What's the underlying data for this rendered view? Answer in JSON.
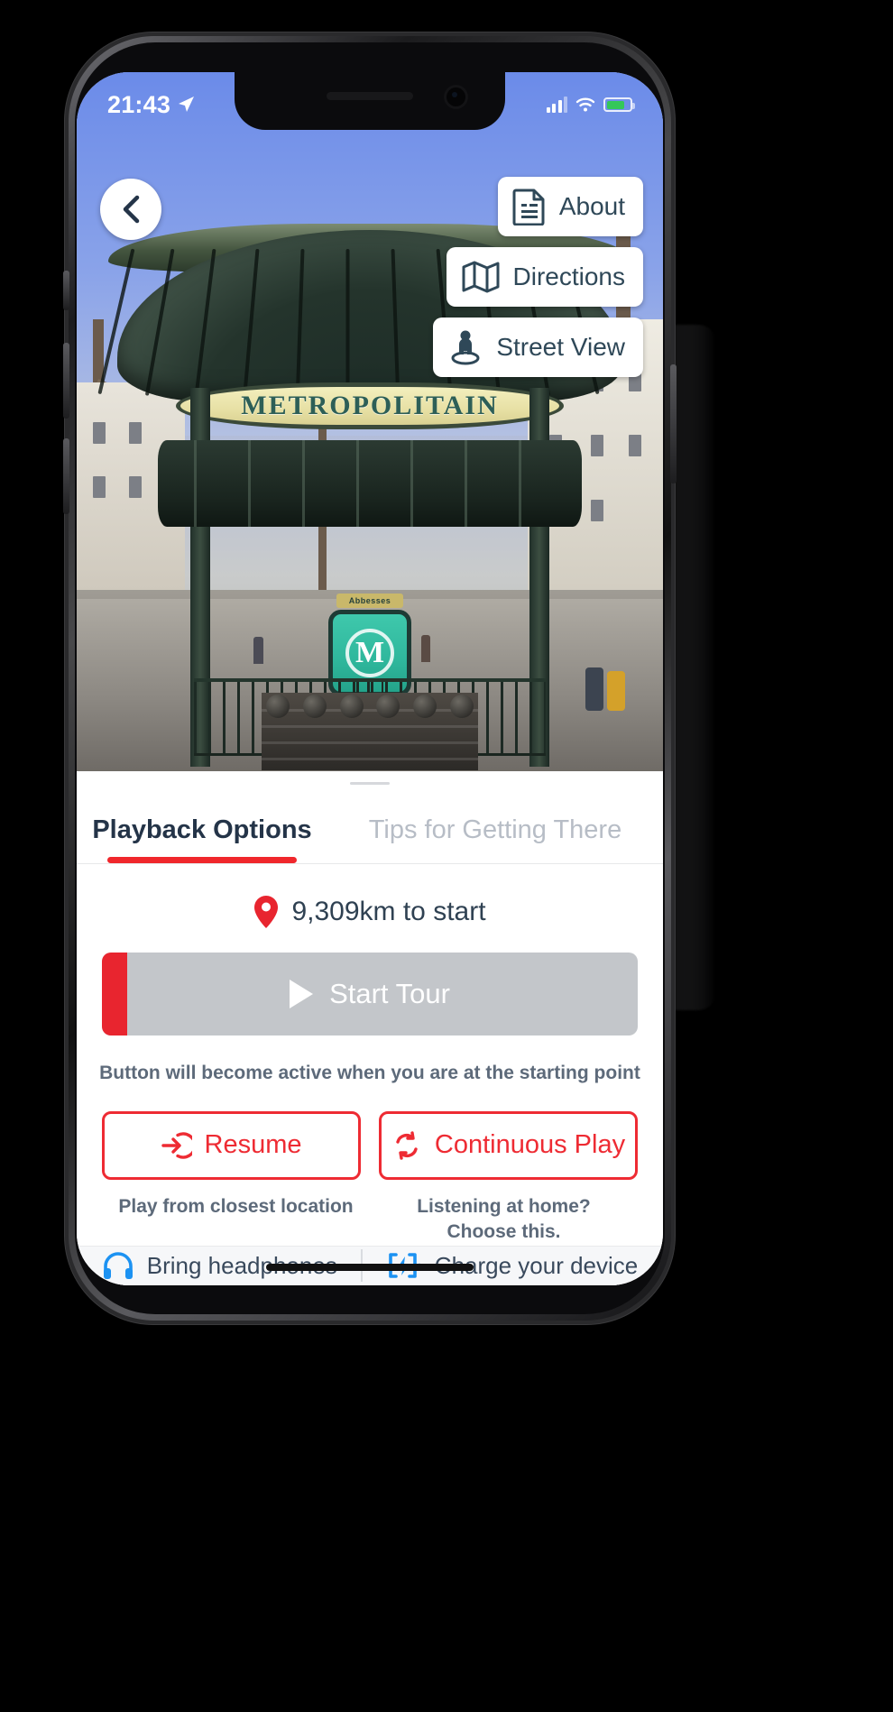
{
  "status_bar": {
    "time": "21:43",
    "location_arrow_icon": "location-arrow-icon",
    "cellular_icon": "cellular-bars-icon",
    "wifi_icon": "wifi-icon",
    "battery_icon": "battery-charging-icon"
  },
  "hero": {
    "back_icon": "chevron-left-icon",
    "sign_text": "METROPOLITAIN",
    "station_name": "Abbesses",
    "metro_letter": "M",
    "actions": [
      {
        "label": "About",
        "icon": "document-icon"
      },
      {
        "label": "Directions",
        "icon": "map-icon"
      },
      {
        "label": "Street View",
        "icon": "pegman-icon"
      }
    ]
  },
  "sheet": {
    "tabs": [
      {
        "label": "Playback Options",
        "active": true
      },
      {
        "label": "Tips for Getting There",
        "active": false
      }
    ],
    "distance": {
      "icon": "map-pin-icon",
      "text": "9,309km to start"
    },
    "start_button": {
      "label": "Start Tour",
      "icon": "play-icon",
      "enabled": false
    },
    "hint": "Button will become active when you are at the starting point",
    "secondary_buttons": [
      {
        "label": "Resume",
        "icon": "sign-in-icon",
        "caption": "Play from closest location"
      },
      {
        "label": "Continuous Play",
        "icon": "repeat-icon",
        "caption": "Listening at home?\nChoose this."
      }
    ],
    "captions": [
      "Play from closest location",
      "Listening at home?"
    ],
    "caption_right_line2": "Choose this.",
    "footer": [
      {
        "label": "Bring headphones",
        "icon": "headphones-icon"
      },
      {
        "label": "Charge your device",
        "icon": "battery-bolt-icon"
      }
    ]
  },
  "colors": {
    "accent_red": "#EE2B33",
    "progress_red": "#E8252F",
    "tab_active": "#243448",
    "tab_inactive": "#b7bdc6",
    "muted_text": "#5d6a7a",
    "icon_blue": "#1C92F2",
    "action_text": "#2f4858",
    "disabled_gray": "#c3c6ca"
  }
}
